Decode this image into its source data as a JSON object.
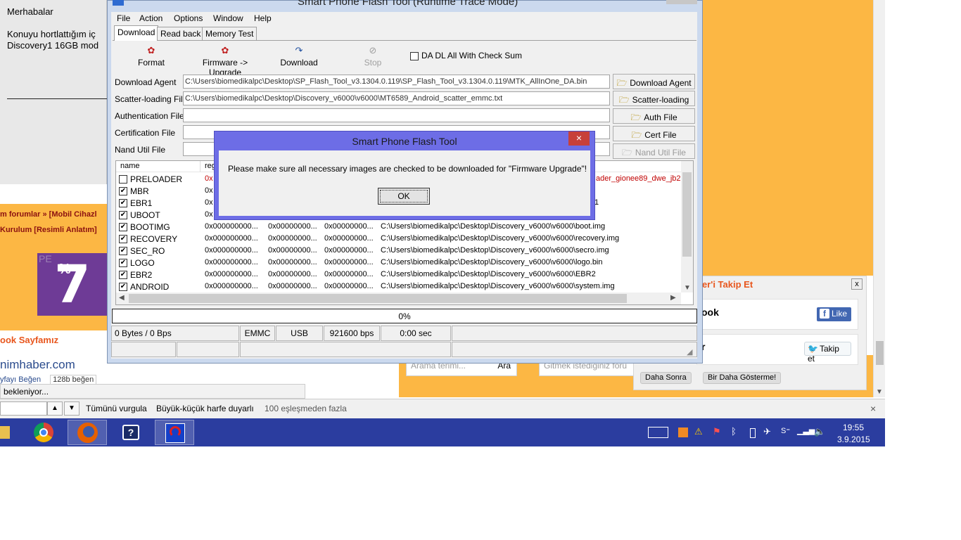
{
  "page": {
    "post_greeting": "Merhabalar",
    "post_line1": "Konuyu hortlattığım iç",
    "post_line2": "Discovery1 16GB mod",
    "breadcrumb": "m forumlar » [Mobil Cihazl",
    "breadcrumb2": "Kurulum [Resimli Anlatım]",
    "promo_pct": "%",
    "promo_num": "7",
    "promo_pe": "PE",
    "fb_section_title": "ook Sayfamız",
    "fb_site": "nimhaber.com",
    "fb_like_left": "yfayı Beğen",
    "fb_like_count": "128b beğen",
    "loading_text": "bekleniyor...",
    "search_placeholder": "Arama terimi...",
    "search_button": "Ara",
    "goto_placeholder": "Gitmek istediğiniz foru"
  },
  "follow": {
    "title": "ber'i Takip Et",
    "close": "x",
    "facebook_label": "ook",
    "like_label": "Like",
    "twitter_label": "r",
    "tweet_label": "Takip et",
    "later_label": "Daha Sonra",
    "never_label": "Bir Daha Gösterme!"
  },
  "findbar": {
    "highlight_all": "Tümünü vurgula",
    "match_case": "Büyük-küçük harfe duyarlı",
    "matches": "100 eşleşmeden fazla",
    "close": "×"
  },
  "taskbar": {
    "time": "19:55",
    "date": "3.9.2015"
  },
  "app": {
    "title": "Smart Phone Flash Tool (Runtime Trace Mode)",
    "menu": [
      "File",
      "Action",
      "Options",
      "Window",
      "Help"
    ],
    "tabs": [
      "Download",
      "Read back",
      "Memory Test"
    ],
    "toolbar": {
      "format": "Format",
      "firmware_upgrade": "Firmware -> Upgrade",
      "download": "Download",
      "stop": "Stop",
      "da_dl": "DA DL All With Check Sum"
    },
    "fields": {
      "download_agent_label": "Download Agent",
      "download_agent_value": "C:\\Users\\biomedikalpc\\Desktop\\SP_Flash_Tool_v3.1304.0.119\\SP_Flash_Tool_v3.1304.0.119\\MTK_AllInOne_DA.bin",
      "scatter_label": "Scatter-loading File",
      "scatter_value": "C:\\Users\\biomedikalpc\\Desktop\\Discovery_v6000\\v6000\\MT6589_Android_scatter_emmc.txt",
      "auth_label": "Authentication File",
      "cert_label": "Certification File",
      "nand_label": "Nand Util File"
    },
    "buttons": {
      "download_agent": "Download Agent",
      "scatter": "Scatter-loading",
      "auth": "Auth File",
      "cert": "Cert File",
      "nand": "Nand Util File"
    },
    "list": {
      "col_name": "name",
      "col_region": "reg",
      "preloader_path_tail": "ader_gionee89_dwe_jb2.l",
      "path_frag_ebr1": "1",
      "rows": [
        {
          "name": "PRELOADER",
          "checked": false,
          "c1": "0x",
          "c2": "",
          "c3": "",
          "path": ""
        },
        {
          "name": "MBR",
          "checked": true,
          "c1": "0x",
          "c2": "",
          "c3": "",
          "path": ""
        },
        {
          "name": "EBR1",
          "checked": true,
          "c1": "0x",
          "c2": "",
          "c3": "",
          "path": ""
        },
        {
          "name": "UBOOT",
          "checked": true,
          "c1": "0x",
          "c2": "",
          "c3": "",
          "path": ""
        },
        {
          "name": "BOOTIMG",
          "checked": true,
          "c1": "0x000000000...",
          "c2": "0x00000000...",
          "c3": "0x00000000...",
          "path": "C:\\Users\\biomedikalpc\\Desktop\\Discovery_v6000\\v6000\\boot.img"
        },
        {
          "name": "RECOVERY",
          "checked": true,
          "c1": "0x000000000...",
          "c2": "0x00000000...",
          "c3": "0x00000000...",
          "path": "C:\\Users\\biomedikalpc\\Desktop\\Discovery_v6000\\v6000\\recovery.img"
        },
        {
          "name": "SEC_RO",
          "checked": true,
          "c1": "0x000000000...",
          "c2": "0x00000000...",
          "c3": "0x00000000...",
          "path": "C:\\Users\\biomedikalpc\\Desktop\\Discovery_v6000\\v6000\\secro.img"
        },
        {
          "name": "LOGO",
          "checked": true,
          "c1": "0x000000000...",
          "c2": "0x00000000...",
          "c3": "0x00000000...",
          "path": "C:\\Users\\biomedikalpc\\Desktop\\Discovery_v6000\\v6000\\logo.bin"
        },
        {
          "name": "EBR2",
          "checked": true,
          "c1": "0x000000000...",
          "c2": "0x00000000...",
          "c3": "0x00000000...",
          "path": "C:\\Users\\biomedikalpc\\Desktop\\Discovery_v6000\\v6000\\EBR2"
        },
        {
          "name": "ANDROID",
          "checked": true,
          "c1": "0x000000000...",
          "c2": "0x00000000...",
          "c3": "0x00000000...",
          "path": "C:\\Users\\biomedikalpc\\Desktop\\Discovery_v6000\\v6000\\system.img"
        }
      ]
    },
    "progress": "0%",
    "status": {
      "bytes": "0 Bytes / 0 Bps",
      "storage": "EMMC",
      "port": "USB",
      "baud": "921600 bps",
      "time": "0:00 sec"
    }
  },
  "dialog": {
    "title": "Smart Phone Flash Tool",
    "message": "Please make sure all necessary images are checked to be downloaded for \"Firmware Upgrade\"!",
    "ok": "OK",
    "close": "×"
  },
  "colors": {
    "accent_orange": "#fcb744",
    "taskbar_blue": "#2b3d9f",
    "dialog_frame": "#6d6de6",
    "close_red": "#c7403a",
    "preloader_red": "#c00000"
  }
}
